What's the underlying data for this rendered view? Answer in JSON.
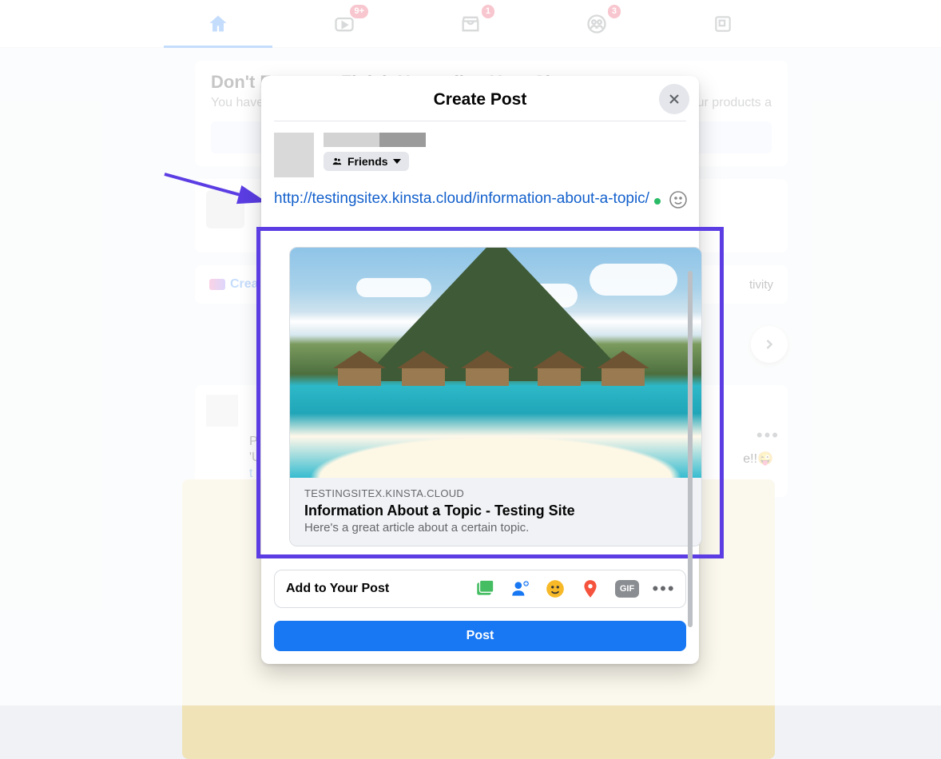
{
  "nav": {
    "badges": {
      "watch": "9+",
      "market": "1",
      "groups": "3"
    }
  },
  "background": {
    "upgrade_title": "Don't Forget to Finish Upgrading Your Shop",
    "upgrade_sub_left": "You haven",
    "upgrade_sub_right": "e your products a",
    "right_text": "tivity",
    "create_label": "Crea",
    "post_fragment_1": "P",
    "post_fragment_2": "'U",
    "post_fragment_3": "t",
    "post_emoji_tail": "e!!😜"
  },
  "modal": {
    "title": "Create Post",
    "audience": "Friends",
    "link": "http://testingsitex.kinsta.cloud/information-about-a-topic/",
    "preview": {
      "domain": "TESTINGSITEX.KINSTA.CLOUD",
      "title": "Information About a Topic - Testing Site",
      "description": "Here's a great article about a certain topic."
    },
    "add_label": "Add to Your Post",
    "submit": "Post"
  }
}
